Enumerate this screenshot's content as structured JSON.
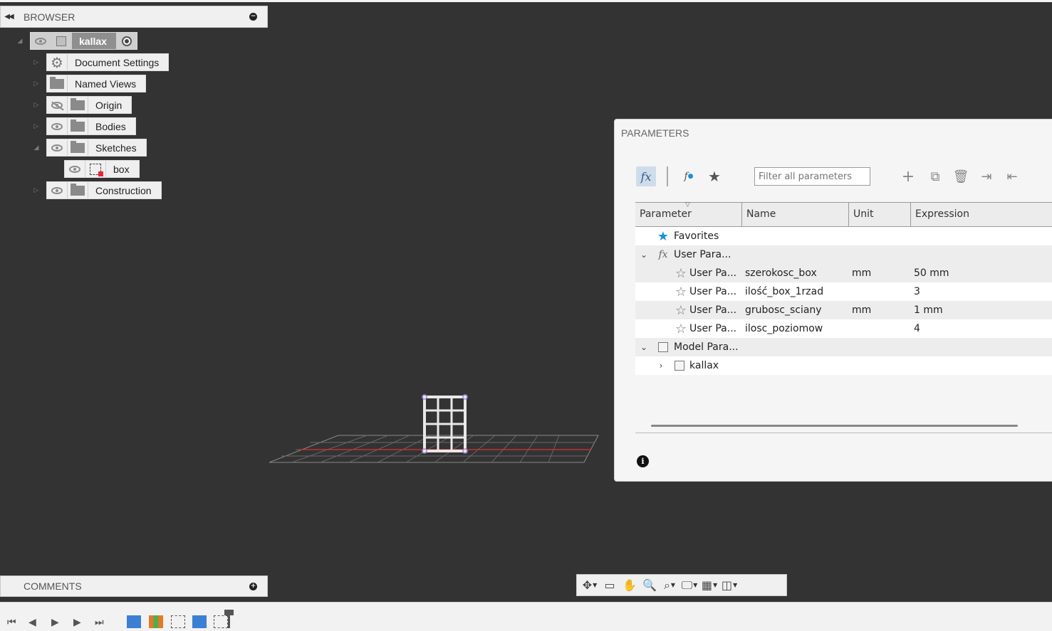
{
  "browser": {
    "title": "BROWSER",
    "root": "kallax",
    "items": [
      {
        "label": "Document Settings",
        "icon": "gear-icon"
      },
      {
        "label": "Named Views",
        "icon": "folder-icon"
      },
      {
        "label": "Origin",
        "icon": "folder-icon",
        "visible": false
      },
      {
        "label": "Bodies",
        "icon": "folder-icon"
      },
      {
        "label": "Sketches",
        "icon": "folder-icon",
        "expanded": true
      },
      {
        "label": "box",
        "icon": "sketch-icon"
      },
      {
        "label": "Construction",
        "icon": "folder-icon"
      }
    ]
  },
  "comments": {
    "title": "COMMENTS"
  },
  "parameters": {
    "title": "PARAMETERS",
    "filter_placeholder": "Filter all parameters",
    "columns": [
      "Parameter",
      "Name",
      "Unit",
      "Expression"
    ],
    "favorites": "Favorites",
    "user_group": "User Para...",
    "rows": [
      {
        "param": "User Pa...",
        "name": "szerokosc_box",
        "unit": "mm",
        "expr": "50 mm"
      },
      {
        "param": "User Pa...",
        "name": "ilość_box_1rzad",
        "unit": "",
        "expr": "3"
      },
      {
        "param": "User Pa...",
        "name": "grubosc_sciany",
        "unit": "mm",
        "expr": "1 mm"
      },
      {
        "param": "User Pa...",
        "name": "ilosc_poziomow",
        "unit": "",
        "expr": "4"
      }
    ],
    "model_group": "Model Para...",
    "model_item": "kallax"
  },
  "colors": {
    "accent": "#1a8fd8",
    "canvas": "#333333"
  }
}
